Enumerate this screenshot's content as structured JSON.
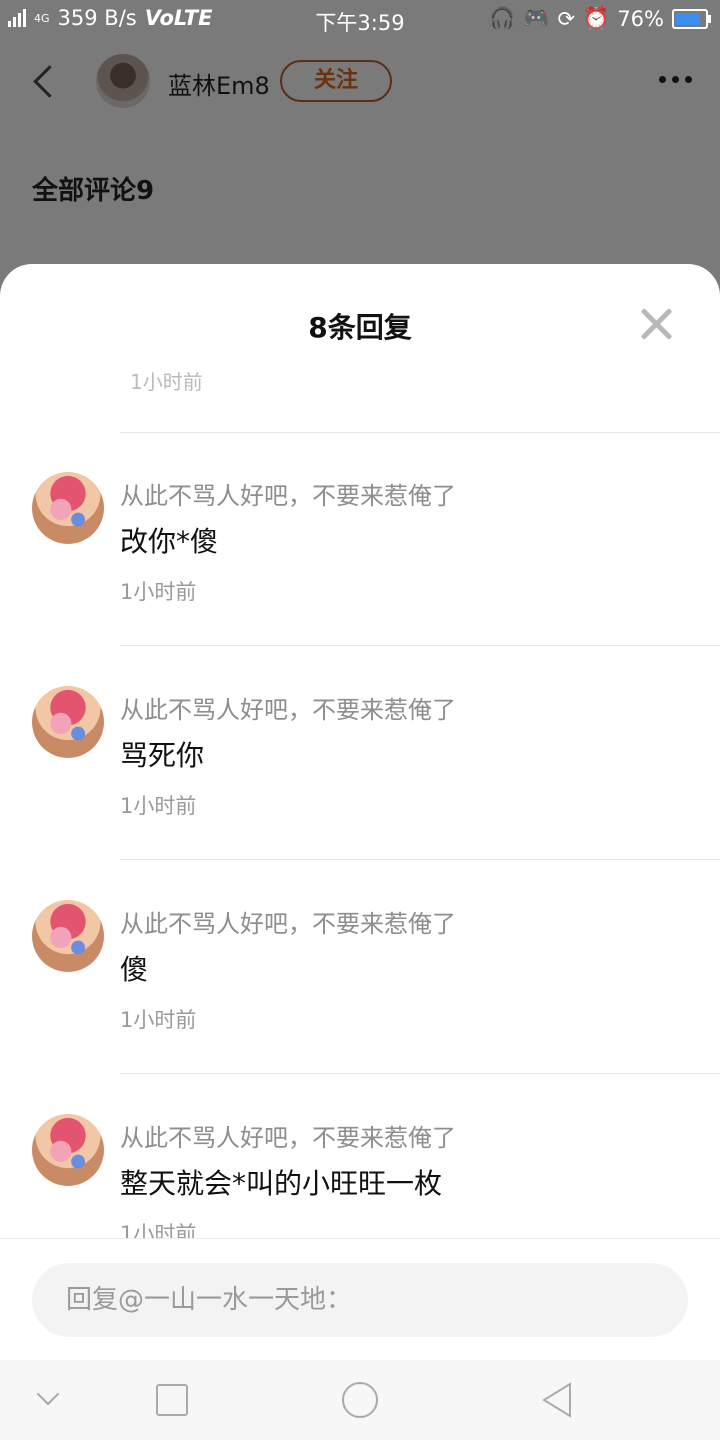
{
  "status_bar": {
    "network": "4G",
    "speed": "359 B/s",
    "volte": "VoLTE",
    "time": "下午3:59",
    "battery": "76%",
    "battery_level": 0.76,
    "icons": [
      "headphones-icon",
      "gamepad-icon",
      "rotation-lock-icon",
      "alarm-icon",
      "battery-icon"
    ]
  },
  "header": {
    "username": "蓝林Em8",
    "follow_label": "关注",
    "section_title": "全部评论9"
  },
  "sheet": {
    "title": "8条回复",
    "replies": [
      {
        "user": "从此不骂人好吧，不要来惹俺了",
        "text": "改你*傻",
        "time": "1小时前"
      },
      {
        "user": "从此不骂人好吧，不要来惹俺了",
        "text": "骂死你",
        "time": "1小时前"
      },
      {
        "user": "从此不骂人好吧，不要来惹俺了",
        "text": "傻",
        "time": "1小时前"
      },
      {
        "user": "从此不骂人好吧，不要来惹俺了",
        "text": "整天就会*叫的小旺旺一枚",
        "time": "1小时前"
      }
    ],
    "input_placeholder": "回复@一山一水一天地："
  },
  "colors": {
    "accent": "#6b3210",
    "overlay": "#7a7a7a",
    "muted_text": "#8e8e8e"
  }
}
